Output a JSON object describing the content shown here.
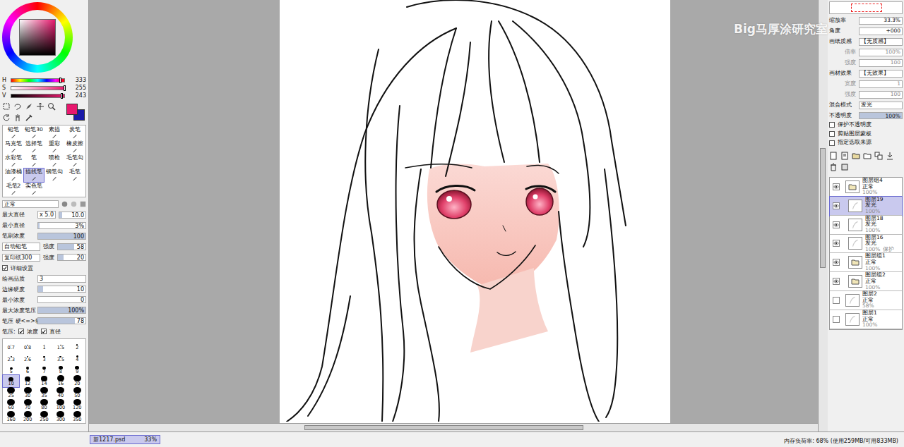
{
  "color_panel": {
    "sliders": [
      {
        "label": "H",
        "value": "333",
        "level": 0.92
      },
      {
        "label": "S",
        "value": "255",
        "level": 1.0
      },
      {
        "label": "V",
        "value": "243",
        "level": 0.95
      }
    ],
    "swatches": [
      {
        "color": "#e8186e"
      },
      {
        "color": "#1a1aa8"
      }
    ]
  },
  "tools": [
    {
      "label": "铅笔",
      "selected": false
    },
    {
      "label": "铅笔30",
      "selected": false
    },
    {
      "label": "素描",
      "selected": false
    },
    {
      "label": "炭笔",
      "selected": false
    },
    {
      "label": "马克笔",
      "selected": false
    },
    {
      "label": "选择笔",
      "selected": false
    },
    {
      "label": "重彩",
      "selected": false
    },
    {
      "label": "橡皮擦",
      "selected": false
    },
    {
      "label": "水彩笔",
      "selected": false
    },
    {
      "label": "笔",
      "selected": false
    },
    {
      "label": "喷枪",
      "selected": false
    },
    {
      "label": "毛笔勾",
      "selected": false
    },
    {
      "label": "油漆桶",
      "selected": false
    },
    {
      "label": "描线笔",
      "selected": true
    },
    {
      "label": "钢笔勾",
      "selected": false
    },
    {
      "label": "毛笔",
      "selected": false
    },
    {
      "label": "毛笔2",
      "selected": false
    },
    {
      "label": "实色笔",
      "selected": false
    }
  ],
  "brush": {
    "mode": "正常",
    "sliders": [
      {
        "label": "最大直径",
        "prefix": "x 5.0",
        "value": "10.0",
        "level": 0.1
      },
      {
        "label": "最小直径",
        "value": "3%",
        "level": 0.03
      },
      {
        "label": "笔刷浓度",
        "value": "100",
        "level": 1.0
      }
    ],
    "textures": [
      {
        "name": "自动铅笔",
        "label": "强度",
        "value": "58",
        "level": 0.58
      },
      {
        "name": "复印纸300",
        "label": "强度",
        "value": "20",
        "level": 0.2
      }
    ],
    "detail": {
      "label": "详细设置",
      "checked": true
    },
    "quality": {
      "label": "绘画品质",
      "value": "3"
    },
    "detail_sliders": [
      {
        "label": "边缘硬度",
        "value": "10",
        "level": 0.1
      },
      {
        "label": "最小浓度",
        "value": "0",
        "level": 0.0
      },
      {
        "label": "最大浓度笔压",
        "value": "100%",
        "level": 1.0
      },
      {
        "label": "笔压 硬<=>软",
        "value": "78",
        "level": 0.78
      }
    ],
    "pressure": {
      "label": "笔压:",
      "options": [
        {
          "label": "浓度",
          "checked": true
        },
        {
          "label": "直径",
          "checked": true
        }
      ]
    }
  },
  "sizes": [
    {
      "label": "0.7",
      "selected": false
    },
    {
      "label": "0.8",
      "selected": false
    },
    {
      "label": "1",
      "selected": false
    },
    {
      "label": "1.5",
      "selected": false
    },
    {
      "label": "2",
      "selected": false
    },
    {
      "label": "2.3",
      "selected": false
    },
    {
      "label": "2.6",
      "selected": false
    },
    {
      "label": "3",
      "selected": false
    },
    {
      "label": "3.5",
      "selected": false
    },
    {
      "label": "4",
      "selected": false
    },
    {
      "label": "5",
      "selected": false
    },
    {
      "label": "6",
      "selected": false
    },
    {
      "label": "7",
      "selected": false
    },
    {
      "label": "8",
      "selected": false
    },
    {
      "label": "9",
      "selected": false
    },
    {
      "label": "10",
      "selected": true
    },
    {
      "label": "12",
      "selected": false
    },
    {
      "label": "14",
      "selected": false
    },
    {
      "label": "16",
      "selected": false
    },
    {
      "label": "20",
      "selected": false
    },
    {
      "label": "25",
      "selected": false
    },
    {
      "label": "30",
      "selected": false
    },
    {
      "label": "35",
      "selected": false
    },
    {
      "label": "40",
      "selected": false
    },
    {
      "label": "50",
      "selected": false
    },
    {
      "label": "60",
      "selected": false
    },
    {
      "label": "70",
      "selected": false
    },
    {
      "label": "80",
      "selected": false
    },
    {
      "label": "100",
      "selected": false
    },
    {
      "label": "120",
      "selected": false
    },
    {
      "label": "160",
      "selected": false
    },
    {
      "label": "200",
      "selected": false
    },
    {
      "label": "250",
      "selected": false
    },
    {
      "label": "300",
      "selected": false
    },
    {
      "label": "350",
      "selected": false
    }
  ],
  "canvas": {
    "watermark": "Big马厚涂研究室"
  },
  "document_tab": {
    "name": "新1217.psd",
    "zoom": "33%"
  },
  "status_bar": "内存负荷率: 68% (使用259MB/可用833MB)",
  "right_panel": {
    "navigator": [
      {
        "label": "缩放率",
        "value": "33.3%"
      },
      {
        "label": "角度",
        "value": "+000"
      }
    ],
    "paper": [
      {
        "label": "画纸质感",
        "value": "【无质感】",
        "sub": [
          {
            "label": "倍率",
            "value": "100%"
          },
          {
            "label": "强度",
            "value": "100"
          }
        ]
      },
      {
        "label": "画材效果",
        "value": "【无效果】",
        "sub": [
          {
            "label": "宽度",
            "value": "1"
          },
          {
            "label": "强度",
            "value": "100"
          }
        ]
      }
    ],
    "blend": {
      "label": "混合模式",
      "value": "发光"
    },
    "opacity": {
      "label": "不透明度",
      "value": "100%",
      "level": 1.0
    },
    "options": [
      {
        "label": "保护不透明度",
        "checked": false
      },
      {
        "label": "剪贴图层蒙板",
        "checked": false
      },
      {
        "label": "指定选取来源",
        "checked": false
      }
    ],
    "layers": [
      {
        "name": "图层组4",
        "mode": "正常",
        "opacity": "100%",
        "kind": "folder",
        "visible": true,
        "nested": false,
        "selected": false
      },
      {
        "name": "图层19",
        "mode": "发光",
        "opacity": "100%",
        "kind": "layer",
        "visible": true,
        "nested": true,
        "selected": true
      },
      {
        "name": "图层18",
        "mode": "发光",
        "opacity": "100%",
        "kind": "layer",
        "visible": true,
        "nested": true,
        "selected": false
      },
      {
        "name": "图层16",
        "mode": "发光",
        "opacity": "100%",
        "tag": "保护",
        "kind": "layer",
        "visible": true,
        "nested": true,
        "selected": false
      },
      {
        "name": "图层组1",
        "mode": "正常",
        "opacity": "100%",
        "kind": "folder",
        "visible": true,
        "nested": true,
        "selected": false
      },
      {
        "name": "图层组2",
        "mode": "正常",
        "opacity": "100%",
        "kind": "folder",
        "visible": true,
        "nested": true,
        "selected": false
      },
      {
        "name": "图层2",
        "mode": "正常",
        "opacity": "58%",
        "kind": "layer",
        "visible": false,
        "nested": false,
        "selected": false
      },
      {
        "name": "图层1",
        "mode": "正常",
        "opacity": "100%",
        "kind": "layer",
        "visible": false,
        "nested": false,
        "selected": false
      }
    ]
  }
}
